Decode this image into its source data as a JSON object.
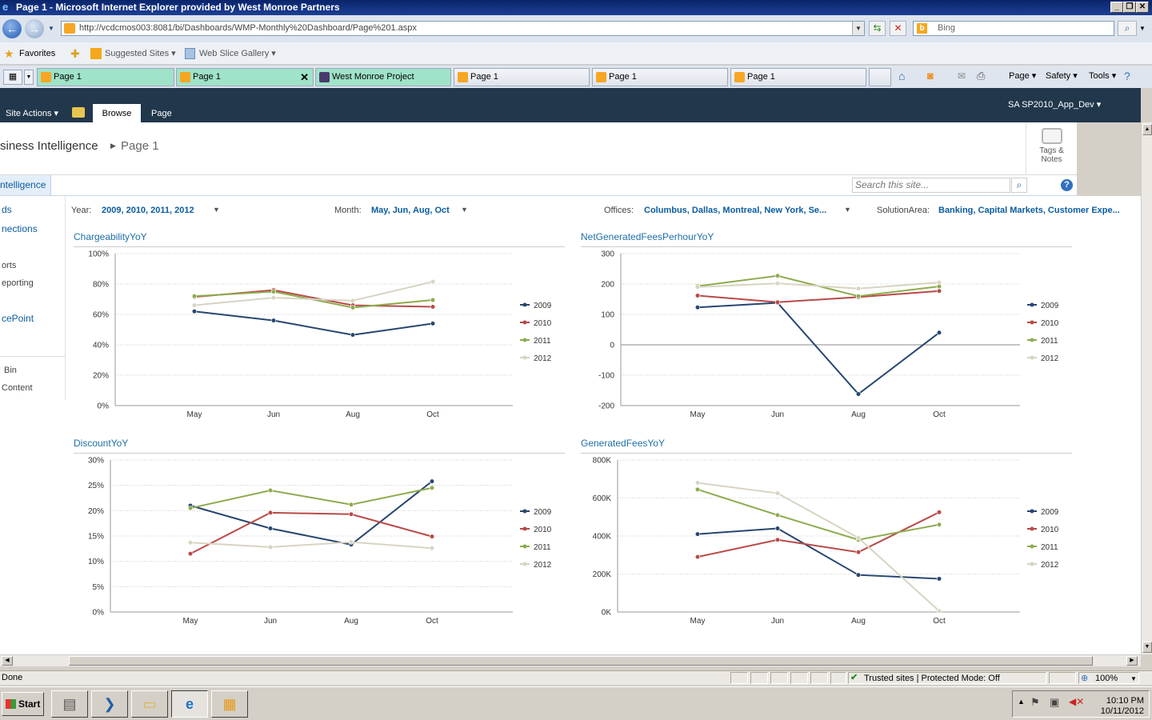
{
  "window": {
    "title": "Page 1 - Microsoft Internet Explorer provided by West Monroe Partners",
    "minimize": "_",
    "restore": "❐",
    "close": "✕"
  },
  "address": {
    "url": "http://vcdcmos003:8081/bi/Dashboards/WMP-Monthly%20Dashboard/Page%201.aspx",
    "search_engine_text": "Bing"
  },
  "favorites_bar": {
    "favorites": "Favorites",
    "suggested_sites": "Suggested Sites ▾",
    "web_slice_gallery": "Web Slice Gallery ▾"
  },
  "tabs": [
    {
      "label": "Page 1",
      "active": false
    },
    {
      "label": "Page 1",
      "active": true
    },
    {
      "label": "West Monroe Project",
      "active": false
    },
    {
      "label": "Page 1",
      "active": false
    },
    {
      "label": "Page 1",
      "active": false
    },
    {
      "label": "Page 1",
      "active": false
    }
  ],
  "command_bar": {
    "page": "Page ▾",
    "safety": "Safety ▾",
    "tools": "Tools ▾"
  },
  "sharepoint": {
    "site_actions": "Site Actions ▾",
    "tab_browse": "Browse",
    "tab_page": "Page",
    "user": "SA SP2010_App_Dev ▾",
    "breadcrumb_site": "siness Intelligence",
    "breadcrumb_page": "Page 1",
    "tags_notes_line1": "Tags &",
    "tags_notes_line2": "Notes",
    "nav_link": "ntelligence",
    "search_placeholder": "Search this site..."
  },
  "left_nav": [
    "ds",
    "nections",
    "orts",
    "eporting",
    "cePoint",
    "Bin",
    "Content"
  ],
  "filters": {
    "year_label": "Year:",
    "year_value": "2009, 2010, 2011, 2012",
    "month_label": "Month:",
    "month_value": "May, Jun, Aug, Oct",
    "offices_label": "Offices:",
    "offices_value": "Columbus, Dallas, Montreal, New York, Se...",
    "solution_label": "SolutionArea:",
    "solution_value": "Banking, Capital Markets, Customer Expe..."
  },
  "colors": {
    "2009": "#27466f",
    "2010": "#b84a47",
    "2011": "#8eab4f",
    "2012": "#d8d4c3"
  },
  "chart_data": [
    {
      "title": "ChargeabilityYoY",
      "type": "line",
      "categories": [
        "May",
        "Jun",
        "Aug",
        "Oct"
      ],
      "ylim": [
        0,
        100
      ],
      "yticks": [
        0,
        20,
        40,
        60,
        80,
        100
      ],
      "ytick_labels": [
        "0%",
        "20%",
        "40%",
        "60%",
        "80%",
        "100%"
      ],
      "series": [
        {
          "name": "2009",
          "values": [
            62,
            56,
            46.5,
            54
          ]
        },
        {
          "name": "2010",
          "values": [
            71.5,
            76,
            66,
            65
          ]
        },
        {
          "name": "2011",
          "values": [
            72,
            75,
            64.5,
            69.5
          ]
        },
        {
          "name": "2012",
          "values": [
            66,
            71,
            69,
            81.5
          ]
        }
      ]
    },
    {
      "title": "NetGeneratedFeesPerhourYoY",
      "type": "line",
      "categories": [
        "May",
        "Jun",
        "Aug",
        "Oct"
      ],
      "ylim": [
        -200,
        300
      ],
      "yticks": [
        -200,
        -100,
        0,
        100,
        200,
        300
      ],
      "ytick_labels": [
        "-200",
        "-100",
        "0",
        "100",
        "200",
        "300"
      ],
      "series": [
        {
          "name": "2009",
          "values": [
            123,
            138,
            -162,
            40
          ]
        },
        {
          "name": "2010",
          "values": [
            162,
            140,
            157,
            177
          ]
        },
        {
          "name": "2011",
          "values": [
            193,
            227,
            160,
            192
          ]
        },
        {
          "name": "2012",
          "values": [
            190,
            202,
            185,
            205
          ]
        }
      ]
    },
    {
      "title": "DiscountYoY",
      "type": "line",
      "categories": [
        "May",
        "Jun",
        "Aug",
        "Oct"
      ],
      "ylim": [
        0,
        30
      ],
      "yticks": [
        0,
        5,
        10,
        15,
        20,
        25,
        30
      ],
      "ytick_labels": [
        "0%",
        "5%",
        "10%",
        "15%",
        "20%",
        "25%",
        "30%"
      ],
      "series": [
        {
          "name": "2009",
          "values": [
            21,
            16.5,
            13.3,
            25.8
          ]
        },
        {
          "name": "2010",
          "values": [
            11.5,
            19.6,
            19.3,
            14.9
          ]
        },
        {
          "name": "2011",
          "values": [
            20.5,
            24,
            21.2,
            24.5
          ]
        },
        {
          "name": "2012",
          "values": [
            13.7,
            12.8,
            13.8,
            12.6
          ]
        }
      ]
    },
    {
      "title": "GeneratedFeesYoY",
      "type": "line",
      "categories": [
        "May",
        "Jun",
        "Aug",
        "Oct"
      ],
      "ylim": [
        0,
        800
      ],
      "yticks": [
        0,
        200,
        400,
        600,
        800
      ],
      "ytick_labels": [
        "0K",
        "200K",
        "400K",
        "600K",
        "800K"
      ],
      "series": [
        {
          "name": "2009",
          "values": [
            410,
            440,
            195,
            175
          ]
        },
        {
          "name": "2010",
          "values": [
            290,
            380,
            315,
            525
          ]
        },
        {
          "name": "2011",
          "values": [
            645,
            510,
            380,
            460
          ]
        },
        {
          "name": "2012",
          "values": [
            680,
            625,
            390,
            5
          ]
        }
      ]
    }
  ],
  "status": {
    "text": "Done",
    "zone": "Trusted sites | Protected Mode: Off",
    "zoom": "100%"
  },
  "taskbar": {
    "start": "Start",
    "time": "10:10 PM",
    "date": "10/11/2012"
  }
}
